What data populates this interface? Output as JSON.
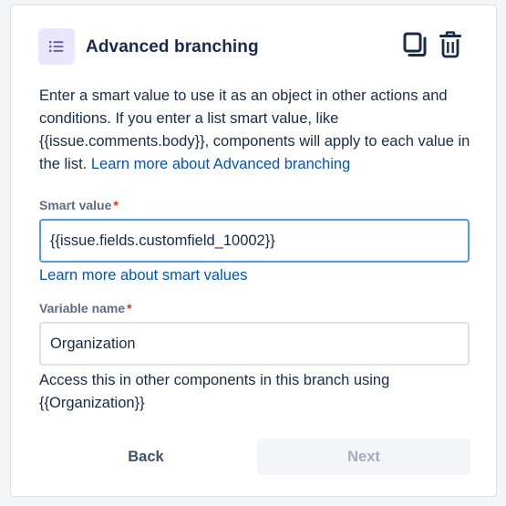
{
  "header": {
    "title": "Advanced branching",
    "icons": {
      "component": "list-icon",
      "copy": "copy-icon",
      "delete": "trash-icon"
    }
  },
  "description": {
    "text": "Enter a smart value to use it as an object in other actions and conditions. If you enter a list smart value, like {{issue.comments.body}}, components will apply to each value in the list. ",
    "link": "Learn more about Advanced branching"
  },
  "smart_value": {
    "label": "Smart value",
    "required_marker": "*",
    "value": "{{issue.fields.customfield_10002}}",
    "help_link": "Learn more about smart values"
  },
  "variable_name": {
    "label": "Variable name",
    "required_marker": "*",
    "value": "Organization",
    "helper": "Access this in other components in this branch using {{Organization}}"
  },
  "actions": {
    "back": "Back",
    "next": "Next"
  },
  "colors": {
    "accent": "#0052cc",
    "focus_border": "#4c9aff",
    "icon_tile": "#eae6ff",
    "icon_glyph": "#6554c0",
    "required": "#de350b",
    "disabled_text": "#a5adba"
  }
}
